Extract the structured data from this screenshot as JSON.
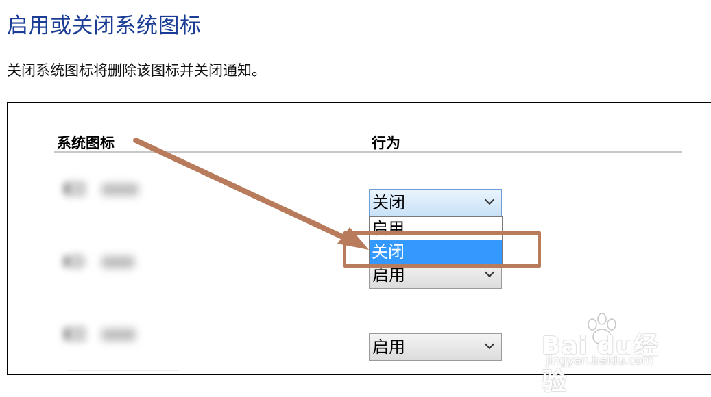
{
  "title": "启用或关闭系统图标",
  "description": "关闭系统图标将删除该图标并关闭通知。",
  "table": {
    "col_icon": "系统图标",
    "col_behavior": "行为",
    "rows": [
      {
        "icon": "clock-icon",
        "value": "关闭"
      },
      {
        "icon": "volume-icon",
        "value": "启用"
      },
      {
        "icon": "network-icon",
        "value": "启用"
      }
    ]
  },
  "dropdown": {
    "options": [
      "启用",
      "关闭"
    ],
    "selected_index": 1
  },
  "annotation": {
    "color": "#b87c5c"
  },
  "watermark": {
    "logo": "Bai du经验",
    "url": "jingyan.baidu.com"
  }
}
